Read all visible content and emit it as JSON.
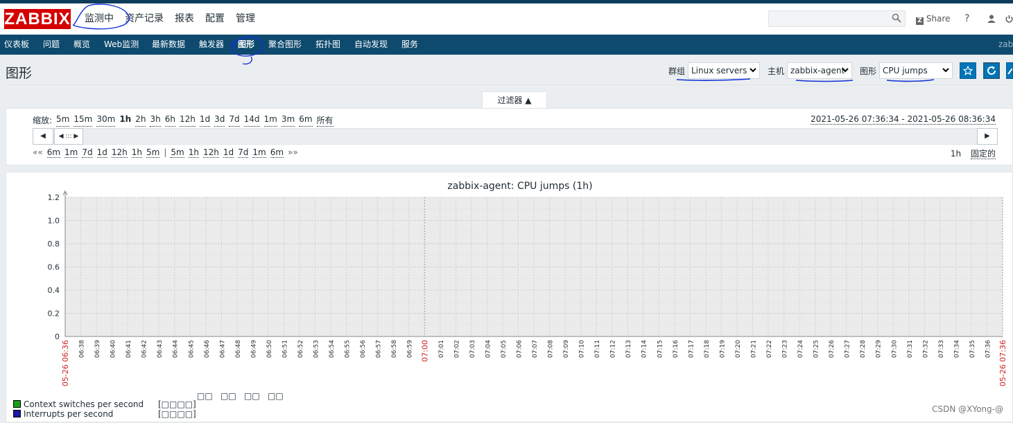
{
  "logo": "ZABBIX",
  "main_menu": [
    "监测中",
    "资产记录",
    "报表",
    "配置",
    "管理"
  ],
  "top_right": {
    "share": "Share",
    "help": "?"
  },
  "sub_menu": [
    "仪表板",
    "问题",
    "概览",
    "Web监测",
    "最新数据",
    "触发器",
    "图形",
    "聚合图形",
    "拓扑图",
    "自动发现",
    "服务"
  ],
  "sub_menu_right": "zab",
  "page": {
    "title": "图形",
    "group_label": "群组",
    "group_value": "Linux servers",
    "host_label": "主机",
    "host_value": "zabbix-agent",
    "graph_label": "图形",
    "graph_value": "CPU jumps"
  },
  "filter": {
    "tab": "过滤器 ▲",
    "zoom_label": "缩放:",
    "zoom_options": [
      "5m",
      "15m",
      "30m",
      "1h",
      "2h",
      "3h",
      "6h",
      "12h",
      "1d",
      "3d",
      "7d",
      "14d",
      "1m",
      "3m",
      "6m",
      "所有"
    ],
    "selected_zoom": "1h",
    "date_range": "2021-05-26 07:36:34 - 2021-05-26 08:36:34",
    "nav_back_marker": "««",
    "nav_back": [
      "6m",
      "1m",
      "7d",
      "1d",
      "12h",
      "1h",
      "5m"
    ],
    "nav_fwd": [
      "5m",
      "1h",
      "12h",
      "1d",
      "7d",
      "1m",
      "6m"
    ],
    "nav_fwd_marker": "»»",
    "period": "1h",
    "fixed": "固定的"
  },
  "chart_data": {
    "type": "line",
    "title": "zabbix-agent: CPU jumps (1h)",
    "ylim": [
      0,
      1.2
    ],
    "yticks": [
      "0",
      "0.2",
      "0.4",
      "0.6",
      "0.8",
      "1.0",
      "1.2"
    ],
    "xticks": [
      "05-26 06:36",
      "06:38",
      "06:39",
      "06:40",
      "06:41",
      "06:42",
      "06:43",
      "06:44",
      "06:45",
      "06:46",
      "06:47",
      "06:48",
      "06:49",
      "06:50",
      "06:51",
      "06:52",
      "06:53",
      "06:54",
      "06:55",
      "06:56",
      "06:57",
      "06:58",
      "06:59",
      "07:00",
      "07:01",
      "07:02",
      "07:03",
      "07:04",
      "07:05",
      "07:06",
      "07:07",
      "07:08",
      "07:09",
      "07:10",
      "07:11",
      "07:12",
      "07:13",
      "07:14",
      "07:15",
      "07:16",
      "07:17",
      "07:18",
      "07:19",
      "07:20",
      "07:21",
      "07:22",
      "07:23",
      "07:24",
      "07:25",
      "07:26",
      "07:27",
      "07:28",
      "07:29",
      "07:30",
      "07:31",
      "07:32",
      "07:33",
      "07:34",
      "07:35",
      "07:36",
      "05-26 07:36"
    ],
    "red_ticks": [
      "05-26 06:36",
      "07:00",
      "05-26 07:36"
    ],
    "legend_headers": [
      "□□",
      "□□",
      "□□",
      "□□"
    ],
    "series": [
      {
        "name": "Context switches per second",
        "color": "#1a9e1a",
        "agg": "[□□□□]",
        "values": []
      },
      {
        "name": "Interrupts per second",
        "color": "#1a1aa3",
        "agg": "[□□□□]",
        "values": []
      }
    ],
    "grid": true
  },
  "watermark": "CSDN @XYong-@"
}
